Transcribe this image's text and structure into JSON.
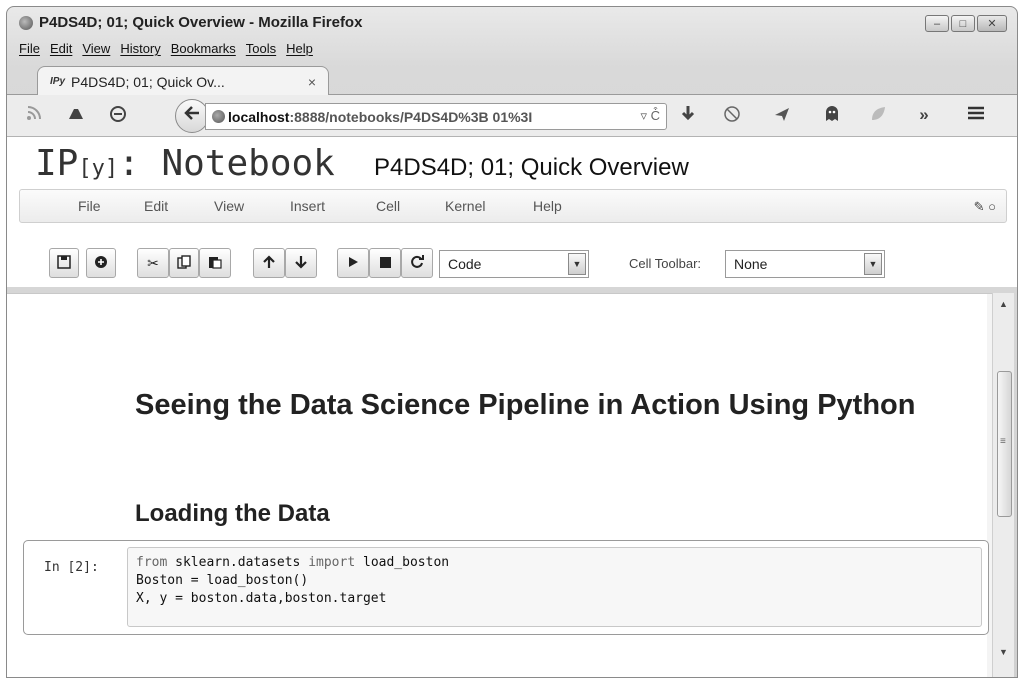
{
  "window": {
    "title": "P4DS4D; 01; Quick Overview - Mozilla Firefox",
    "controls": {
      "minimize": "–",
      "maximize": "□",
      "close": "✕"
    }
  },
  "menubar": [
    "File",
    "Edit",
    "View",
    "History",
    "Bookmarks",
    "Tools",
    "Help"
  ],
  "tab": {
    "favicon": "IPy",
    "label": "P4DS4D; 01; Quick Ov...",
    "close": "×"
  },
  "navbar": {
    "icons": [
      "rss-icon",
      "jupyter-icon",
      "shield-icon",
      "back-icon",
      "download-icon",
      "blocker-icon",
      "send-icon",
      "ghost-icon",
      "leaf-icon",
      "overflow-icon",
      "hamburger-menu-icon"
    ],
    "back": "🠠",
    "url": {
      "host": "localhost",
      "path": ":8888/notebooks/P4DS4D%3B 01%3I",
      "right_icons": "▿ C͒"
    }
  },
  "notebook": {
    "logo_ip": "IP",
    "logo_y": "[y]",
    "logo_rest": ": Notebook",
    "name": "P4DS4D; 01; Quick Overview",
    "menus": [
      "File",
      "Edit",
      "View",
      "Insert",
      "Cell",
      "Kernel",
      "Help"
    ],
    "indicator": "✎ ○"
  },
  "toolbar": {
    "cell_type": "Code",
    "cell_toolbar_label": "Cell Toolbar:",
    "cell_toolbar_value": "None"
  },
  "content": {
    "heading1": "Seeing the Data Science Pipeline in Action Using Python",
    "heading2": "Loading the Data",
    "cell_prompt": "In [2]:",
    "code": {
      "line1_kw1": "from",
      "line1_mid": " sklearn.datasets ",
      "line1_kw2": "import",
      "line1_end": " load_boston",
      "line2": "Boston = load_boston()",
      "line3": "X, y = boston.data,boston.target"
    }
  },
  "colors": {
    "window_chrome": "#d9d9d9",
    "page": "#ffffff",
    "code_bg": "#f7f7f7"
  }
}
